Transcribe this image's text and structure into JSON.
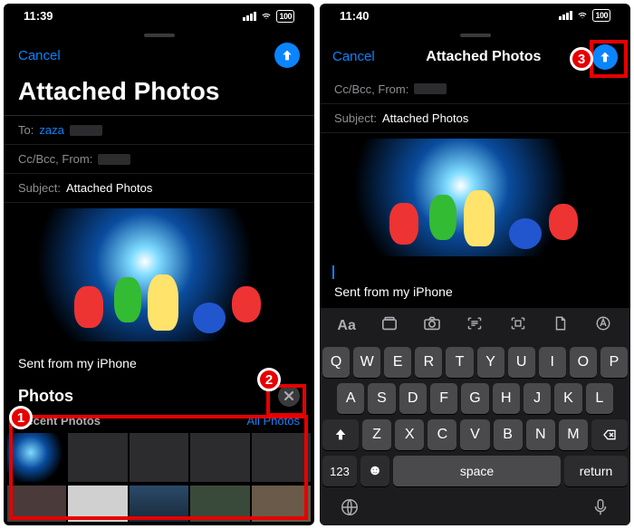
{
  "left": {
    "status_time": "11:39",
    "battery": "100",
    "cancel": "Cancel",
    "title": "Attached Photos",
    "to_label": "To:",
    "to_value": "zaza",
    "cc_label": "Cc/Bcc, From:",
    "subject_label": "Subject:",
    "subject_value": "Attached Photos",
    "signature": "Sent from my iPhone",
    "photos_header": "Photos",
    "recent_label": "Recent Photos",
    "all_photos": "All Photos"
  },
  "right": {
    "status_time": "11:40",
    "battery": "100",
    "cancel": "Cancel",
    "title": "Attached Photos",
    "cc_label": "Cc/Bcc, From:",
    "subject_label": "Subject:",
    "subject_value": "Attached Photos",
    "signature": "Sent from my iPhone",
    "format_aa": "Aa"
  },
  "keyboard": {
    "row1": [
      "Q",
      "W",
      "E",
      "R",
      "T",
      "Y",
      "U",
      "I",
      "O",
      "P"
    ],
    "row2": [
      "A",
      "S",
      "D",
      "F",
      "G",
      "H",
      "J",
      "K",
      "L"
    ],
    "row3": [
      "Z",
      "X",
      "C",
      "V",
      "B",
      "N",
      "M"
    ],
    "numkey": "123",
    "space": "space",
    "return": "return"
  },
  "annotations": {
    "n1": "1",
    "n2": "2",
    "n3": "3"
  }
}
